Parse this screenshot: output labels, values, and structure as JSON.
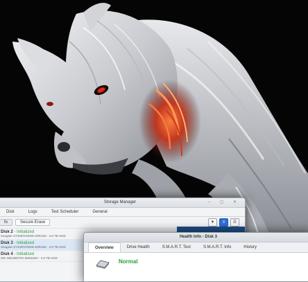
{
  "background": {
    "color": "#050505",
    "art": "white-wolf-illustration"
  },
  "storage_manager": {
    "title": "Storage Manager",
    "tabs": [
      "Disk",
      "Logs",
      "Test Scheduler",
      "General"
    ],
    "toolbar": {
      "secure_erase": "Secure Erase"
    },
    "disks": [
      {
        "name": "Disk 2",
        "status": "- Initialized",
        "meta": "Seagate ST4000VN008-2DR166 - 3.6 TB HDD"
      },
      {
        "name": "Disk 3",
        "status": "- Initialized",
        "meta": "Seagate ST4000VN008-2DR166 - 3.6 TB HDD"
      },
      {
        "name": "Disk 4",
        "status": "- Initialized",
        "meta": "WD WD40EFRX-68N32N0 - 3.6 TB HDD"
      }
    ]
  },
  "health_info": {
    "title": "Health Info - Disk 3",
    "tabs": [
      "Overview",
      "Drive Health",
      "S.M.A.R.T. Test",
      "S.M.A.R.T. Info",
      "History"
    ],
    "status": "Normal"
  },
  "colors": {
    "accent": "#2f6fd6",
    "status_ok": "#2e9b3a",
    "side_panel": "#1f4f86"
  }
}
